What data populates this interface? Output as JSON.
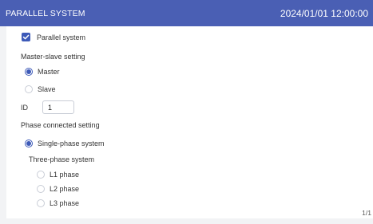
{
  "header": {
    "title": "PARALLEL SYSTEM",
    "datetime": "2024/01/01 12:00:00"
  },
  "parallel": {
    "label": "Parallel system",
    "checked": true
  },
  "master_slave": {
    "label": "Master-slave setting",
    "options": [
      {
        "label": "Master",
        "selected": true
      },
      {
        "label": "Slave",
        "selected": false
      }
    ]
  },
  "id_field": {
    "label": "ID",
    "value": "1"
  },
  "phase": {
    "label": "Phase connected setting",
    "single_label": "Single-phase system",
    "single_selected": true,
    "three_label": "Three-phase system",
    "three_options": [
      {
        "label": "L1 phase",
        "selected": false
      },
      {
        "label": "L2 phase",
        "selected": false
      },
      {
        "label": "L3 phase",
        "selected": false
      }
    ]
  },
  "pagination": {
    "text": "1/1"
  },
  "colors": {
    "header_bg": "#4a5fb4",
    "accent": "#3d5ab8",
    "page_bg": "#f2f3f5"
  }
}
